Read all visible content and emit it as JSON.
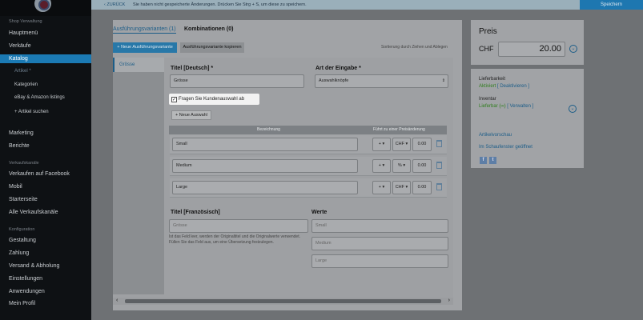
{
  "sidebar": {
    "header_shop": "Shop Verwaltung",
    "items_top": [
      "Hauptmenü",
      "Verkäufe"
    ],
    "active": "Katalog",
    "sub": [
      "Artikel *",
      "Kategorien",
      "eBay & Amazon listings"
    ],
    "sub_add": "+  Artikel suchen",
    "items_mid": [
      "Marketing",
      "Berichte"
    ],
    "header_channels": "Verkaufskanäle",
    "channels": [
      "Verkaufen auf Facebook",
      "Mobil",
      "Starterseite",
      "Alle Verkaufskanäle"
    ],
    "header_config": "Konfiguration",
    "config": [
      "Gestaltung",
      "Zahlung",
      "Versand & Abholung",
      "Einstellungen",
      "Anwendungen",
      "Mein Profil"
    ]
  },
  "topbar": {
    "back": "ZURÜCK",
    "message": "Sie haben nicht gespeicherte Änderungen. Drücken Sie Strg + S, um diese zu speichern.",
    "save": "Speichern"
  },
  "tabs": {
    "variants": "Ausführungsvarianten (1)",
    "combinations": "Kombinationen (0)"
  },
  "buttons": {
    "new_variant": "+ Neue Ausführungsvariante",
    "copy_variant": "Ausführungsvariante kopieren",
    "new_option": "+ Neue Auswahl"
  },
  "sort_hint": "Sortierung durch Ziehen und Ablegen",
  "variant_tab": "Grösse",
  "form": {
    "title_de_label": "Titel [Deutsch] *",
    "title_de_value": "Grösse",
    "input_type_label": "Art der Eingabe *",
    "input_type_value": "Auswahlknöpfe",
    "checkbox_label": "Fragen Sie Kundenauswahl ab",
    "table_headers": [
      "Bezeichnung",
      "Führt zu einer Preisänderung"
    ],
    "rows": [
      {
        "name": "Small",
        "sign": "+",
        "unit": "CHF",
        "value": "0.00"
      },
      {
        "name": "Medium",
        "sign": "+",
        "unit": "%",
        "value": "0.00"
      },
      {
        "name": "Large",
        "sign": "+",
        "unit": "CHF",
        "value": "0.00"
      }
    ],
    "title_fr_label": "Titel [Französisch]",
    "title_fr_placeholder": "Grösse",
    "values_label": "Werte",
    "values_placeholders": [
      "Small",
      "Medium",
      "Large"
    ],
    "hint": "Ist das Feld leer, werden der Originaltitel und die Originalwerte verwendet. Füllen Sie das Feld aus, um eine Übersetzung festzulegen."
  },
  "price": {
    "label": "Preis",
    "currency": "CHF",
    "value": "20.00"
  },
  "availability": {
    "label": "Lieferbarkeit",
    "active": "Aktiviert",
    "deactivate": "[ Deaktivieren ]",
    "inventory_label": "Inventar",
    "in_stock": "Lieferbar (∞)",
    "manage": "[ Verwalten ]",
    "preview": "Artikelvorschau",
    "showcase": "Im Schaufenster geöffnet"
  },
  "colors": {
    "accent": "#1c5d88",
    "sidebar_active": "#1b7ab4",
    "green": "#2f7d1d"
  }
}
